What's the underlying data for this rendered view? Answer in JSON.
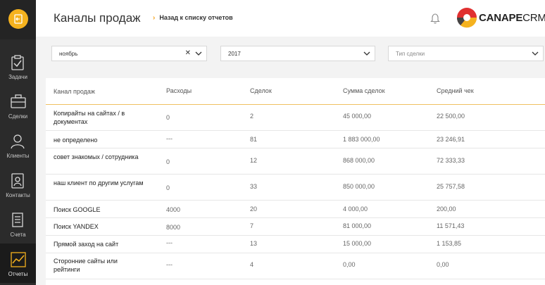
{
  "sidebar": {
    "items": [
      {
        "label": "Задачи",
        "icon": "clipboard-check-icon"
      },
      {
        "label": "Сделки",
        "icon": "briefcase-icon"
      },
      {
        "label": "Клиенты",
        "icon": "person-icon"
      },
      {
        "label": "Контакты",
        "icon": "contact-card-icon"
      },
      {
        "label": "Счета",
        "icon": "document-icon"
      },
      {
        "label": "Отчеты",
        "icon": "chart-icon",
        "active": true
      }
    ],
    "accent": "#f5b21e"
  },
  "header": {
    "title": "Каналы продаж",
    "back_link": "Назад к списку отчетов",
    "brand_bold": "CANAPE",
    "brand_light": "CRM"
  },
  "filters": {
    "month": "ноябрь",
    "year": "2017",
    "deal_type_placeholder": "Тип сделки"
  },
  "table": {
    "columns": [
      "Канал продаж",
      "Расходы",
      "Сделок",
      "Сумма сделок",
      "Средний чек"
    ],
    "rows": [
      {
        "channel": "Копирайты на сайтах / в документах",
        "expenses": "0",
        "deals": "2",
        "sum": "45 000,00",
        "avg": "22 500,00"
      },
      {
        "channel": "не определено",
        "expenses": "---",
        "deals": "81",
        "sum": "1 883 000,00",
        "avg": "23 246,91"
      },
      {
        "channel": "совет знакомых / сотрудника",
        "expenses": "0",
        "deals": "12",
        "sum": "868 000,00",
        "avg": "72 333,33"
      },
      {
        "channel": "наш клиент по другим услугам",
        "expenses": "0",
        "deals": "33",
        "sum": "850 000,00",
        "avg": "25 757,58"
      },
      {
        "channel": "Поиск GOOGLE",
        "expenses": "4000",
        "deals": "20",
        "sum": "4 000,00",
        "avg": "200,00"
      },
      {
        "channel": "Поиск YANDEX",
        "expenses": "8000",
        "deals": "7",
        "sum": "81 000,00",
        "avg": "11 571,43"
      },
      {
        "channel": "Прямой заход на сайт",
        "expenses": "---",
        "deals": "13",
        "sum": "15 000,00",
        "avg": "1 153,85"
      },
      {
        "channel": "Сторонние сайты или рейтинги",
        "expenses": "---",
        "deals": "4",
        "sum": "0,00",
        "avg": "0,00"
      }
    ]
  }
}
